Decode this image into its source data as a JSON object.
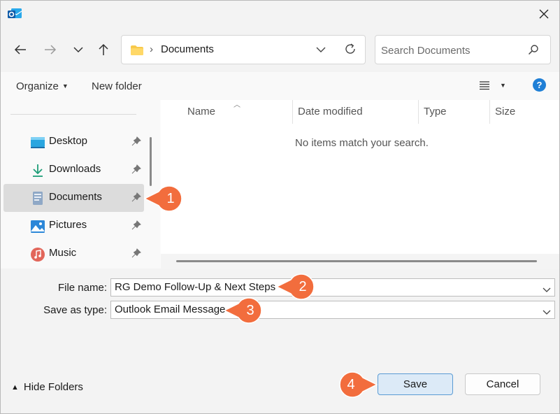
{
  "window": {
    "app_icon": "outlook-icon",
    "close_icon": "close-icon"
  },
  "nav": {
    "back_icon": "arrow-left-icon",
    "forward_icon": "arrow-right-icon",
    "recent_icon": "chevron-down-icon",
    "up_icon": "arrow-up-icon"
  },
  "address": {
    "path": "Documents",
    "separator": "›"
  },
  "search": {
    "placeholder": "Search Documents"
  },
  "command_bar": {
    "organize_label": "Organize",
    "new_folder_label": "New folder",
    "help_label": "?"
  },
  "sidebar": {
    "items": [
      {
        "label": "Desktop",
        "icon": "desktop-icon",
        "pinned": true
      },
      {
        "label": "Downloads",
        "icon": "download-icon",
        "pinned": true
      },
      {
        "label": "Documents",
        "icon": "documents-icon",
        "pinned": true,
        "selected": true
      },
      {
        "label": "Pictures",
        "icon": "pictures-icon",
        "pinned": true
      },
      {
        "label": "Music",
        "icon": "music-icon",
        "pinned": true
      }
    ]
  },
  "file_list": {
    "columns": [
      "Name",
      "Date modified",
      "Type",
      "Size"
    ],
    "empty_message": "No items match your search."
  },
  "form": {
    "file_name_label": "File name:",
    "file_name_value": "RG Demo Follow-Up & Next Steps",
    "save_type_label": "Save as type:",
    "save_type_value": "Outlook Email Message"
  },
  "footer": {
    "hide_folders_label": "Hide Folders",
    "save_label": "Save",
    "cancel_label": "Cancel"
  },
  "callouts": [
    "1",
    "2",
    "3",
    "4"
  ],
  "colors": {
    "callout": "#f26d3d",
    "accent": "#1f7fd6",
    "primary_button": "#dceaf7"
  }
}
